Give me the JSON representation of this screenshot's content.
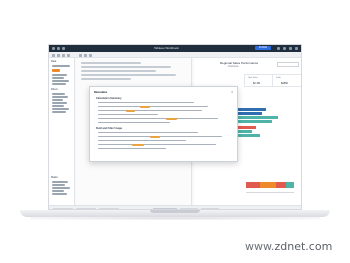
{
  "app": {
    "window_title": "Tableau Workbook"
  },
  "toolbar": {
    "publish_label": "Publish"
  },
  "left_pane": {
    "section_data": "Data",
    "section_filters": "Filters",
    "section_marks": "Marks"
  },
  "dialog": {
    "title": "Metadata",
    "section1_heading": "Calculation Summary",
    "section2_heading": "Field and Filter Usage"
  },
  "dashboard": {
    "heading": "Regional Sales Performance",
    "subheading": "Overview",
    "kpis": [
      {
        "label": "Total Sales",
        "value": "$2.3M"
      },
      {
        "label": "Profit",
        "value": "$286K"
      },
      {
        "label": "Orders",
        "value": "5,009"
      }
    ]
  },
  "colors": {
    "topbar": "#1f2d3d",
    "accent_blue": "#2d6cdf",
    "accent_orange": "#ef8a2a",
    "bar_teal": "#4fb3a8",
    "bar_red": "#e05a4f",
    "highlight": "#e9a341"
  },
  "watermark": {
    "lead": "www.",
    "domain": "zdnet.com"
  }
}
